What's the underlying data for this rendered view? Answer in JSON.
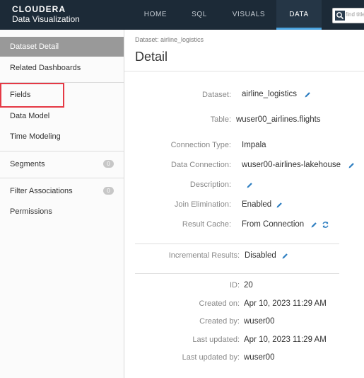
{
  "brand": {
    "name": "CLOUDERA",
    "product": "Data Visualization"
  },
  "nav": [
    {
      "label": "HOME",
      "active": false
    },
    {
      "label": "SQL",
      "active": false
    },
    {
      "label": "VISUALS",
      "active": false
    },
    {
      "label": "DATA",
      "active": true
    }
  ],
  "search": {
    "placeholder": "find title"
  },
  "sidebar": {
    "items": [
      {
        "label": "Dataset Detail",
        "active": true
      },
      {
        "label": "Related Dashboards"
      },
      {
        "label": "Fields"
      },
      {
        "label": "Data Model"
      },
      {
        "label": "Time Modeling"
      },
      {
        "label": "Segments",
        "badge": "0"
      },
      {
        "label": "Filter Associations",
        "badge": "0"
      },
      {
        "label": "Permissions"
      }
    ]
  },
  "main": {
    "breadcrumb": "Dataset: airline_logistics",
    "title": "Detail",
    "fields": {
      "dataset": {
        "label": "Dataset:",
        "value": "airline_logistics"
      },
      "table": {
        "label": "Table:",
        "value": "wuser00_airlines.flights"
      },
      "connection_type": {
        "label": "Connection Type:",
        "value": "Impala"
      },
      "data_connection": {
        "label": "Data Connection:",
        "value": "wuser00-airlines-lakehouse"
      },
      "description": {
        "label": "Description:",
        "value": ""
      },
      "join_elimination": {
        "label": "Join Elimination:",
        "value": "Enabled"
      },
      "result_cache": {
        "label": "Result Cache:",
        "value": "From Connection"
      },
      "incremental_results": {
        "label": "Incremental Results:",
        "value": "Disabled"
      },
      "id": {
        "label": "ID:",
        "value": "20"
      },
      "created_on": {
        "label": "Created on:",
        "value": "Apr 10, 2023 11:29 AM"
      },
      "created_by": {
        "label": "Created by:",
        "value": "wuser00"
      },
      "last_updated": {
        "label": "Last updated:",
        "value": "Apr 10, 2023 11:29 AM"
      },
      "last_updated_by": {
        "label": "Last updated by:",
        "value": "wuser00"
      }
    }
  },
  "colors": {
    "topbar": "#1c2a37",
    "accent": "#4aa3df",
    "pencil": "#2f7fc1",
    "highlight": "#e53945"
  }
}
